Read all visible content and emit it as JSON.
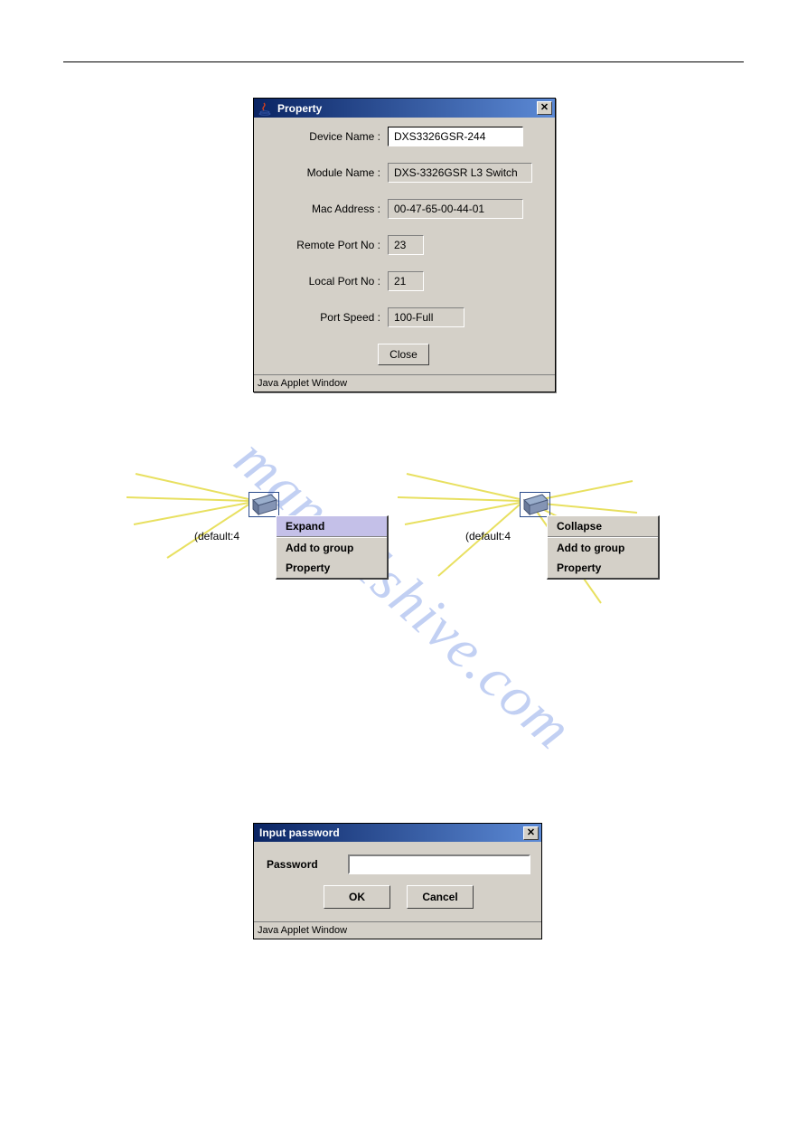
{
  "property_dialog": {
    "title": "Property",
    "rows": {
      "device_name_label": "Device Name :",
      "device_name_value": "DXS3326GSR-244",
      "module_name_label": "Module Name :",
      "module_name_value": "DXS-3326GSR L3 Switch",
      "mac_address_label": "Mac Address :",
      "mac_address_value": "00-47-65-00-44-01",
      "remote_port_label": "Remote Port No :",
      "remote_port_value": "23",
      "local_port_label": "Local Port No :",
      "local_port_value": "21",
      "port_speed_label": "Port Speed :",
      "port_speed_value": "100-Full"
    },
    "close_label": "Close",
    "status_strip": "Java Applet Window"
  },
  "context_area": {
    "left": {
      "device_label": "(default:4",
      "menu": {
        "item0": "Expand",
        "item1": "Add to group",
        "item2": "Property"
      }
    },
    "right": {
      "device_label": "(default:4",
      "menu": {
        "item0": "Collapse",
        "item1": "Add to group",
        "item2": "Property"
      }
    }
  },
  "password_dialog": {
    "title": "Input password",
    "password_label": "Password",
    "password_value": "",
    "ok_label": "OK",
    "cancel_label": "Cancel",
    "status_strip": "Java Applet Window"
  },
  "watermark": "manualshive.com"
}
